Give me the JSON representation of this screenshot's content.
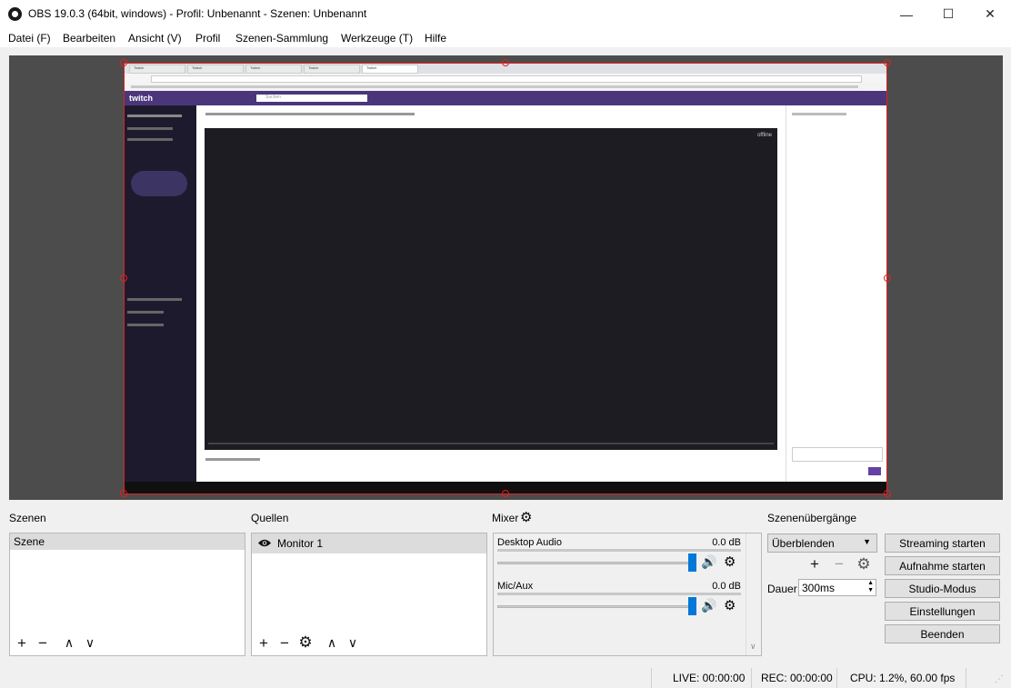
{
  "window": {
    "title": "OBS 19.0.3 (64bit, windows) - Profil: Unbenannt - Szenen: Unbenannt",
    "minimize_glyph": "—",
    "maximize_glyph": "☐",
    "close_glyph": "✕"
  },
  "menu": [
    "Datei (F)",
    "Bearbeiten",
    "Ansicht (V)",
    "Profil",
    "Szenen-Sammlung",
    "Werkzeuge (T)",
    "Hilfe"
  ],
  "preview": {
    "border_color": "#e02020",
    "screen": {
      "tabs": [
        "Twitch",
        "Twitch",
        "Twitch",
        "Twitch",
        "Twitch"
      ],
      "twitch_logo": "twitch",
      "video_badge": "offline",
      "search_placeholder": "Suchen"
    }
  },
  "scenes": {
    "title": "Szenen",
    "items": [
      "Szene"
    ],
    "toolbar": {
      "add": "+",
      "remove": "−",
      "up": "∧",
      "down": "∨"
    }
  },
  "sources": {
    "title": "Quellen",
    "items": [
      "Monitor 1"
    ],
    "toolbar": {
      "add": "+",
      "remove": "−",
      "settings": "⚙",
      "up": "∧",
      "down": "∨"
    }
  },
  "mixer": {
    "title": "Mixer",
    "channels": [
      {
        "name": "Desktop Audio",
        "level": "0.0 dB",
        "volume": 1.0
      },
      {
        "name": "Mic/Aux",
        "level": "0.0 dB",
        "volume": 1.0
      }
    ],
    "speaker_glyph": "🔊",
    "gear_glyph": "⚙"
  },
  "transitions": {
    "title": "Szenenübergänge",
    "selected": "Überblenden",
    "add": "+",
    "remove": "−",
    "settings": "⚙",
    "duration_label": "Dauer",
    "duration_value": "300ms"
  },
  "controls": {
    "start_streaming": "Streaming starten",
    "start_recording": "Aufnahme starten",
    "studio_mode": "Studio-Modus",
    "settings": "Einstellungen",
    "exit": "Beenden"
  },
  "status": {
    "live": "LIVE: 00:00:00",
    "rec": "REC: 00:00:00",
    "cpu": "CPU: 1.2%, 60.00 fps"
  },
  "colors": {
    "accent": "#0078d7",
    "twitch_purple": "#4b367c"
  }
}
